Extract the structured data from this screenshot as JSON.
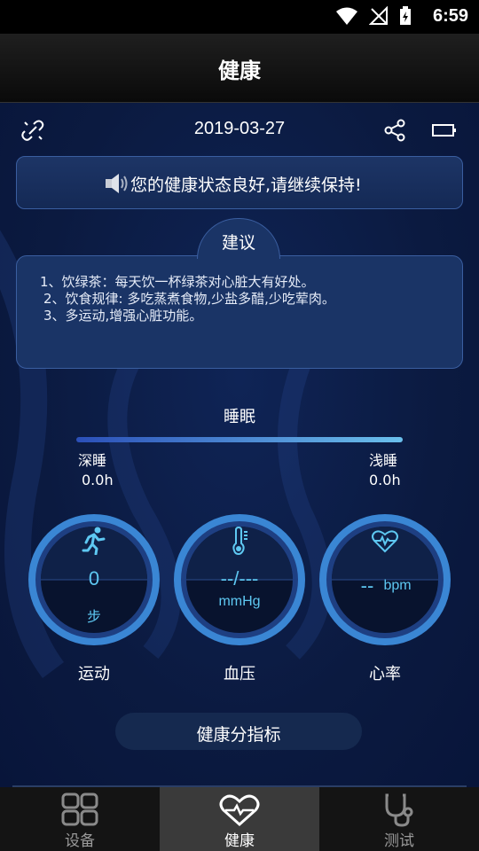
{
  "status_bar": {
    "time": "6:59"
  },
  "header": {
    "title": "健康"
  },
  "toolbar": {
    "date": "2019-03-27"
  },
  "status_card": {
    "message": "您的健康状态良好,请继续保持!"
  },
  "advice": {
    "title": "建议",
    "items": [
      "1、饮绿茶：每天饮一杯绿茶对心脏大有好处。",
      "2、饮食规律: 多吃蒸煮食物,少盐多醋,少吃荤肉。",
      "3、多运动,增强心脏功能。"
    ]
  },
  "sleep": {
    "title": "睡眠",
    "deep_label": "深睡",
    "deep_value": "0.0h",
    "light_label": "浅睡",
    "light_value": "0.0h"
  },
  "gauges": [
    {
      "value": "0",
      "unit": "步",
      "label": "运动",
      "icon": "running-icon"
    },
    {
      "value": "--/---",
      "unit": "mmHg",
      "label": "血压",
      "icon": "thermometer-icon"
    },
    {
      "value": "--",
      "unit": "bpm",
      "label": "心率",
      "icon": "heart-pulse-icon"
    }
  ],
  "score_button": {
    "label": "健康分指标"
  },
  "bottom_nav": [
    {
      "label": "设备",
      "icon": "grid-icon",
      "active": false
    },
    {
      "label": "健康",
      "icon": "heart-icon",
      "active": true
    },
    {
      "label": "测试",
      "icon": "stethoscope-icon",
      "active": false
    }
  ],
  "colors": {
    "accent": "#4aa3e0",
    "background": "#0b1a3d",
    "gauge_ring": "#3f8fd8"
  }
}
